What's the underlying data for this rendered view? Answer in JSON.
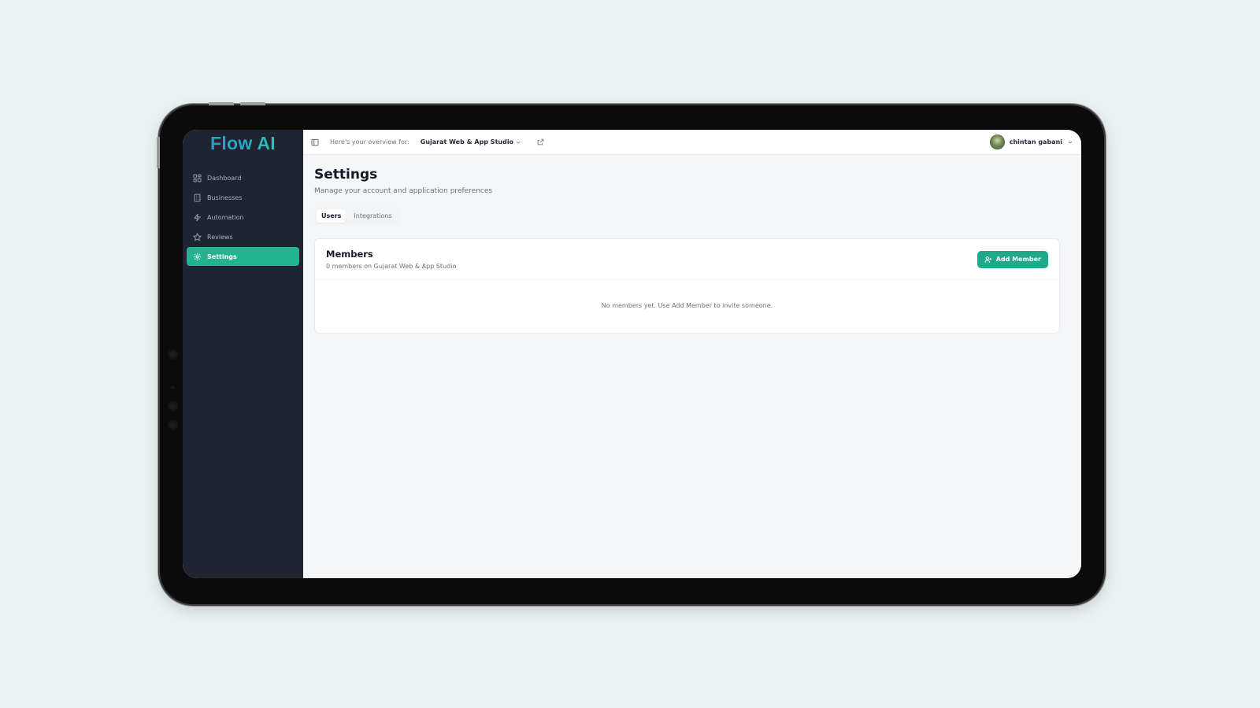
{
  "sidebar": {
    "logo": "Flow AI",
    "items": [
      {
        "label": "Dashboard",
        "icon": "dashboard-icon",
        "active": false
      },
      {
        "label": "Businesses",
        "icon": "building-icon",
        "active": false
      },
      {
        "label": "Automation",
        "icon": "lightning-icon",
        "active": false
      },
      {
        "label": "Reviews",
        "icon": "star-icon",
        "active": false
      },
      {
        "label": "Settings",
        "icon": "gear-icon",
        "active": true
      }
    ]
  },
  "topbar": {
    "overview_label": "Here's your overview for:",
    "business_name": "Gujarat Web & App Studio",
    "user_name": "chintan gabani"
  },
  "page": {
    "title": "Settings",
    "subtitle": "Manage your account and application preferences",
    "tabs": [
      {
        "label": "Users",
        "active": true
      },
      {
        "label": "Integrations",
        "active": false
      }
    ]
  },
  "members": {
    "title": "Members",
    "subtitle": "0 members on Gujarat Web & App Studio",
    "add_button": "Add Member",
    "empty_text": "No members yet. Use Add Member to invite someone."
  },
  "colors": {
    "accent": "#24b38f",
    "sidebar_bg": "#1f2430",
    "page_bg": "#e9f1f3"
  }
}
